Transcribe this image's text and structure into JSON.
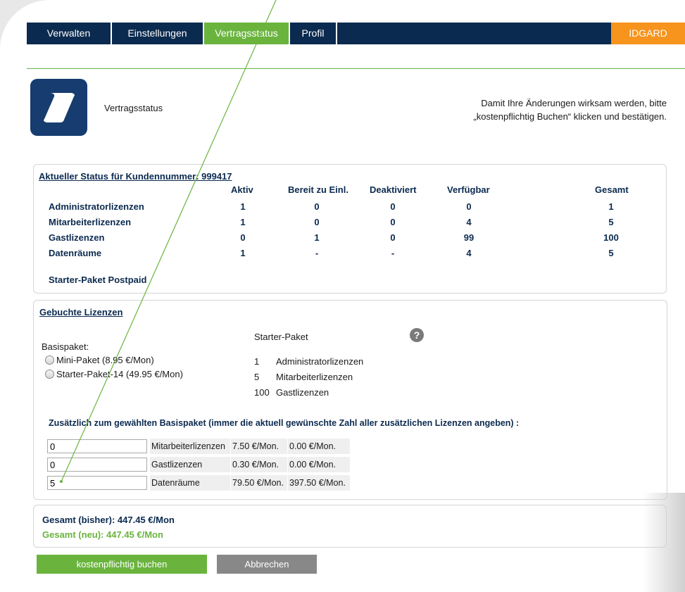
{
  "nav": {
    "tabs": [
      {
        "label": "Verwalten"
      },
      {
        "label": "Einstellungen"
      },
      {
        "label": "Vertragsstatus"
      },
      {
        "label": "Profil"
      }
    ],
    "brand": "IDGARD"
  },
  "header": {
    "title": "Vertragsstatus",
    "notice_line1": "Damit Ihre Änderungen wirksam werden, bitte",
    "notice_line2": "„kostenpflichtig Buchen“ klicken und bestätigen."
  },
  "status": {
    "title": "Aktueller Status für Kundennummer: 999417",
    "columns": [
      "Aktiv",
      "Bereit zu Einl.",
      "Deaktiviert",
      "Verfügbar",
      "Gesamt"
    ],
    "rows": [
      {
        "label": "Administratorlizenzen",
        "values": [
          "1",
          "0",
          "0",
          "0",
          "1"
        ]
      },
      {
        "label": "Mitarbeiterlizenzen",
        "values": [
          "1",
          "0",
          "0",
          "4",
          "5"
        ]
      },
      {
        "label": "Gastlizenzen",
        "values": [
          "0",
          "1",
          "0",
          "99",
          "100"
        ]
      },
      {
        "label": "Datenräume",
        "values": [
          "1",
          "-",
          "-",
          "4",
          "5"
        ]
      }
    ],
    "package": "Starter-Paket Postpaid"
  },
  "booked": {
    "title": "Gebuchte Lizenzen",
    "basis_label": "Basispaket:",
    "options": [
      {
        "label": "Mini-Paket (8.95 €/Mon)"
      },
      {
        "label": "Starter-Paket-14 (49.95 €/Mon)"
      }
    ],
    "package_name": "Starter-Paket",
    "help_glyph": "?",
    "package_items": [
      {
        "count": "1",
        "label": "Administratorlizenzen"
      },
      {
        "count": "5",
        "label": "Mitarbeiterlizenzen"
      },
      {
        "count": "100",
        "label": "Gastlizenzen"
      }
    ],
    "additional_label": "Zusätzlich zum gewählten Basispaket (immer die aktuell gewünschte Zahl aller zusätzlichen Lizenzen angeben) :",
    "extras": [
      {
        "value": "0",
        "label": "Mitarbeiterlizenzen",
        "unit_price": "7.50 €/Mon.",
        "total": "0.00 €/Mon."
      },
      {
        "value": "0",
        "label": "Gastlizenzen",
        "unit_price": "0.30 €/Mon.",
        "total": "0.00 €/Mon."
      },
      {
        "value": "5",
        "label": "Datenräume",
        "unit_price": "79.50 €/Mon.",
        "total": "397.50 €/Mon."
      }
    ]
  },
  "totals": {
    "old": "Gesamt (bisher):  447.45 €/Mon",
    "new": "Gesamt (neu):  447.45 €/Mon"
  },
  "buttons": {
    "book": "kostenpflichtig buchen",
    "cancel": "Abbrechen"
  },
  "colors": {
    "navy": "#0b2a4f",
    "green": "#6ab43e",
    "orange": "#f7941d"
  },
  "icons": {
    "logo": "scroll-icon",
    "help": "help-icon"
  }
}
